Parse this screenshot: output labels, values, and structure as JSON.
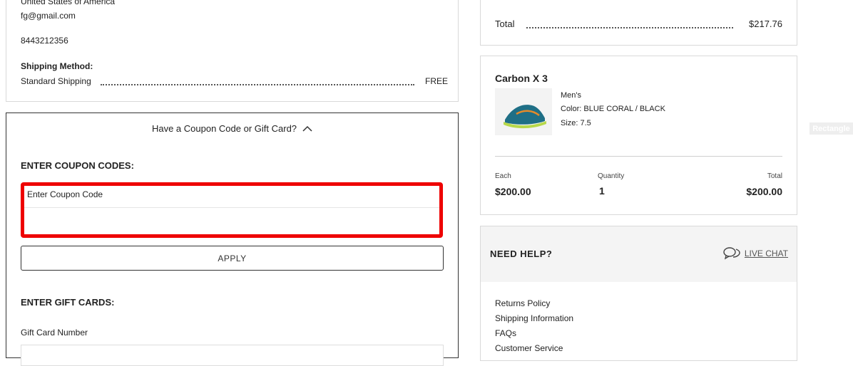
{
  "shipping": {
    "country": "United States of America",
    "email": "fg@gmail.com",
    "phone": "8443212356",
    "method_heading": "Shipping Method:",
    "method_name": "Standard Shipping",
    "method_price": "FREE"
  },
  "coupon": {
    "toggle_label": "Have a Coupon Code or Gift Card?",
    "coupon_heading": "ENTER COUPON CODES:",
    "coupon_field_label": "Enter Coupon Code",
    "coupon_value": "",
    "apply_label": "APPLY",
    "gift_heading": "ENTER GIFT CARDS:",
    "gift_field_label": "Gift Card Number"
  },
  "summary": {
    "total_label": "Total",
    "total_value": "$217.76"
  },
  "product": {
    "name": "Carbon X 3",
    "gender": "Men's",
    "color": "Color: BLUE CORAL / BLACK",
    "size": "Size: 7.5",
    "each_label": "Each",
    "each_value": "$200.00",
    "qty_label": "Quantity",
    "qty_value": "1",
    "total_label": "Total",
    "total_value": "$200.00",
    "image_colors": {
      "upper": "#1f6f86",
      "accent": "#e58a2a",
      "sole": "#b7d84a"
    }
  },
  "help": {
    "heading": "NEED HELP?",
    "chat_label": "LIVE CHAT",
    "links": [
      "Returns Policy",
      "Shipping Information",
      "FAQs",
      "Customer Service"
    ]
  },
  "overlay": {
    "tag": "Rectangle"
  }
}
